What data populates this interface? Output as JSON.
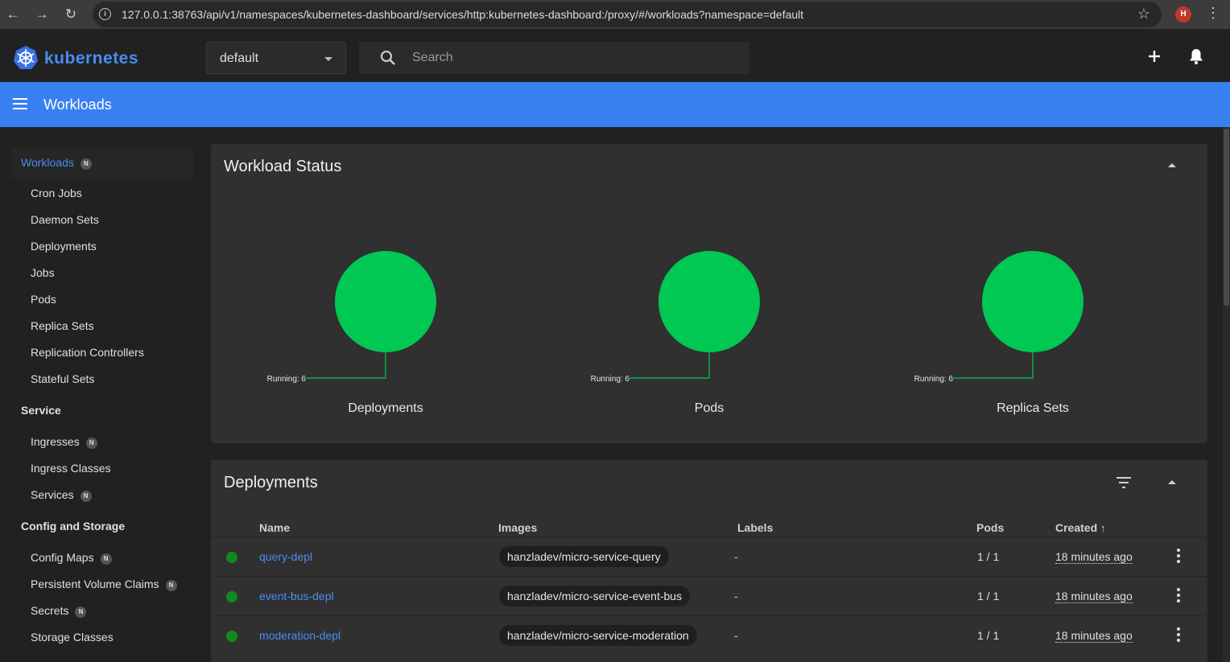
{
  "browser": {
    "url": "127.0.0.1:38763/api/v1/namespaces/kubernetes-dashboard/services/http:kubernetes-dashboard:/proxy/#/workloads?namespace=default",
    "profile_initial": "H",
    "info_glyph": "i"
  },
  "toolbar": {
    "logo_text": "kubernetes",
    "namespace": "default",
    "search_placeholder": "Search"
  },
  "header": {
    "title": "Workloads"
  },
  "sidebar": {
    "badge": "N",
    "active": "Workloads",
    "workloads_items": [
      "Cron Jobs",
      "Daemon Sets",
      "Deployments",
      "Jobs",
      "Pods",
      "Replica Sets",
      "Replication Controllers",
      "Stateful Sets"
    ],
    "service_title": "Service",
    "service_items": [
      "Ingresses",
      "Ingress Classes",
      "Services"
    ],
    "config_title": "Config and Storage",
    "config_items": [
      "Config Maps",
      "Persistent Volume Claims",
      "Secrets",
      "Storage Classes"
    ]
  },
  "workload_status": {
    "title": "Workload Status",
    "charts": [
      {
        "name": "Deployments",
        "label": "Running: 6",
        "running": 6
      },
      {
        "name": "Pods",
        "label": "Running: 6",
        "running": 6
      },
      {
        "name": "Replica Sets",
        "label": "Running: 6",
        "running": 6
      }
    ],
    "running_color": "#00c853"
  },
  "deployments": {
    "title": "Deployments",
    "columns": {
      "name": "Name",
      "images": "Images",
      "labels": "Labels",
      "pods": "Pods",
      "created": "Created"
    },
    "rows": [
      {
        "name": "query-depl",
        "image": "hanzladev/micro-service-query",
        "labels": "-",
        "pods": "1 / 1",
        "created": "18 minutes ago"
      },
      {
        "name": "event-bus-depl",
        "image": "hanzladev/micro-service-event-bus",
        "labels": "-",
        "pods": "1 / 1",
        "created": "18 minutes ago"
      },
      {
        "name": "moderation-depl",
        "image": "hanzladev/micro-service-moderation",
        "labels": "-",
        "pods": "1 / 1",
        "created": "18 minutes ago"
      }
    ]
  },
  "colors": {
    "accent": "#3880f0",
    "link": "#4a8cf0",
    "status_ok": "#0f8a1f"
  }
}
